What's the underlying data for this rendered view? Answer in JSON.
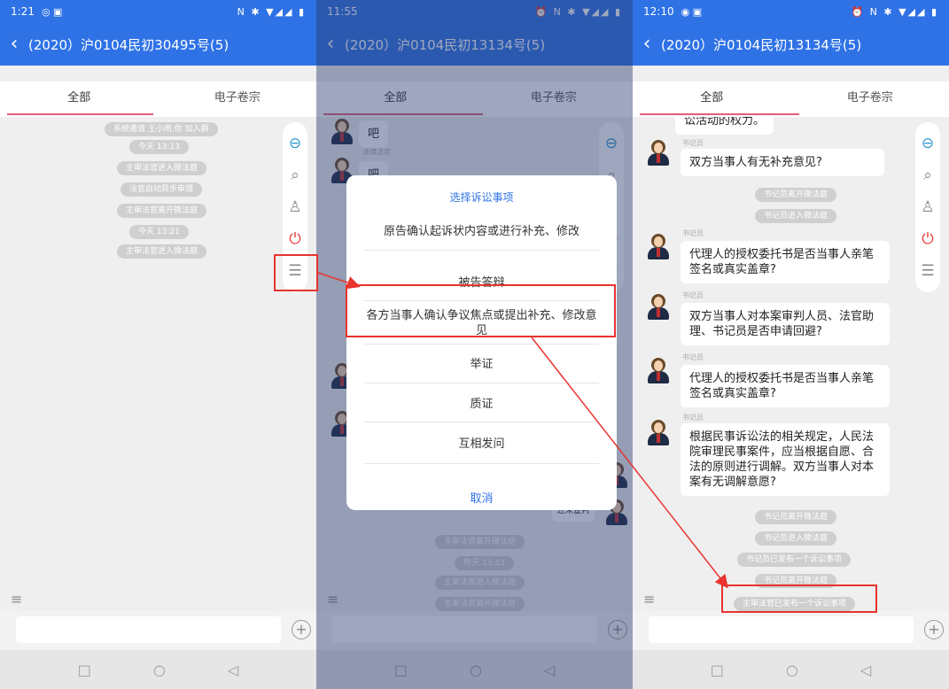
{
  "screens": [
    {
      "status": {
        "time": "1:21",
        "left_icons": "◎ ▣",
        "right_icons": "N ✱ ▼◢◢ ▮"
      },
      "title": "(2020）沪0104民初30495号(5)",
      "tabs": [
        "全部",
        "电子卷宗"
      ],
      "events": [
        "系统邀请 王小雨,你 加入群",
        "今天 13:13",
        "主审法官进入微法庭",
        "法官启动异步审理",
        "主审法官离开微法庭",
        "今天 13:21",
        "主审法官进入微法庭"
      ]
    },
    {
      "status": {
        "time": "11:55",
        "left_icons": "",
        "right_icons": "⏰ N ✱ ▼◢◢ ▮"
      },
      "title": "(2020）沪0104民初13134号(5)",
      "tabs": [
        "全部",
        "电子卷宗"
      ],
      "bg_messages": [
        "吧",
        "吧"
      ],
      "bg_sender": "法律法官",
      "bg_events": [
        "主审法官离开微法庭",
        "昨天 13:13",
        "主审法官进入微法庭",
        "主审法官离开微法庭"
      ],
      "bg_partial": "还未宣判",
      "dialog": {
        "title": "选择诉讼事项",
        "options": [
          "原告确认起诉状内容或进行补充、修改",
          "被告答辩",
          "各方当事人确认争议焦点或提出补充、修改意见",
          "举证",
          "质证",
          "互相发问"
        ],
        "cancel": "取消"
      }
    },
    {
      "status": {
        "time": "12:10",
        "left_icons": "◉ ▣",
        "right_icons": "⏰ N ✱ ▼◢◢ ▮"
      },
      "title": "(2020）沪0104民初13134号(5)",
      "tabs": [
        "全部",
        "电子卷宗"
      ],
      "top_cut": "讼活动的权力。",
      "sender": "书记员",
      "messages": [
        "双方当事人有无补充意见?",
        "代理人的授权委托书是否当事人亲笔签名或真实盖章?",
        "双方当事人对本案审判人员、法官助理、书记员是否申请回避?",
        "代理人的授权委托书是否当事人亲笔签名或真实盖章?",
        "根据民事诉讼法的相关规定，人民法院审理民事案件，应当根据自愿、合法的原则进行调解。双方当事人对本案有无调解意愿?"
      ],
      "events_a": [
        "书记员离开微法庭",
        "书记员进入微法庭"
      ],
      "events_b": [
        "书记员离开微法庭",
        "书记员进入微法庭",
        "书记员已发布一个诉讼事项",
        "书记员离开微法庭",
        "主审法官已发布一个诉讼事项"
      ]
    }
  ],
  "icons": {
    "back": "chevron-left-icon",
    "record": "record-icon",
    "search": "search-icon",
    "members": "members-icon",
    "power": "power-icon",
    "form": "form-icon",
    "menu": "menu-icon",
    "plus": "plus-icon"
  },
  "colors": {
    "primary": "#2f72e6",
    "accent": "#e45d78",
    "annotation": "#e8332f"
  }
}
